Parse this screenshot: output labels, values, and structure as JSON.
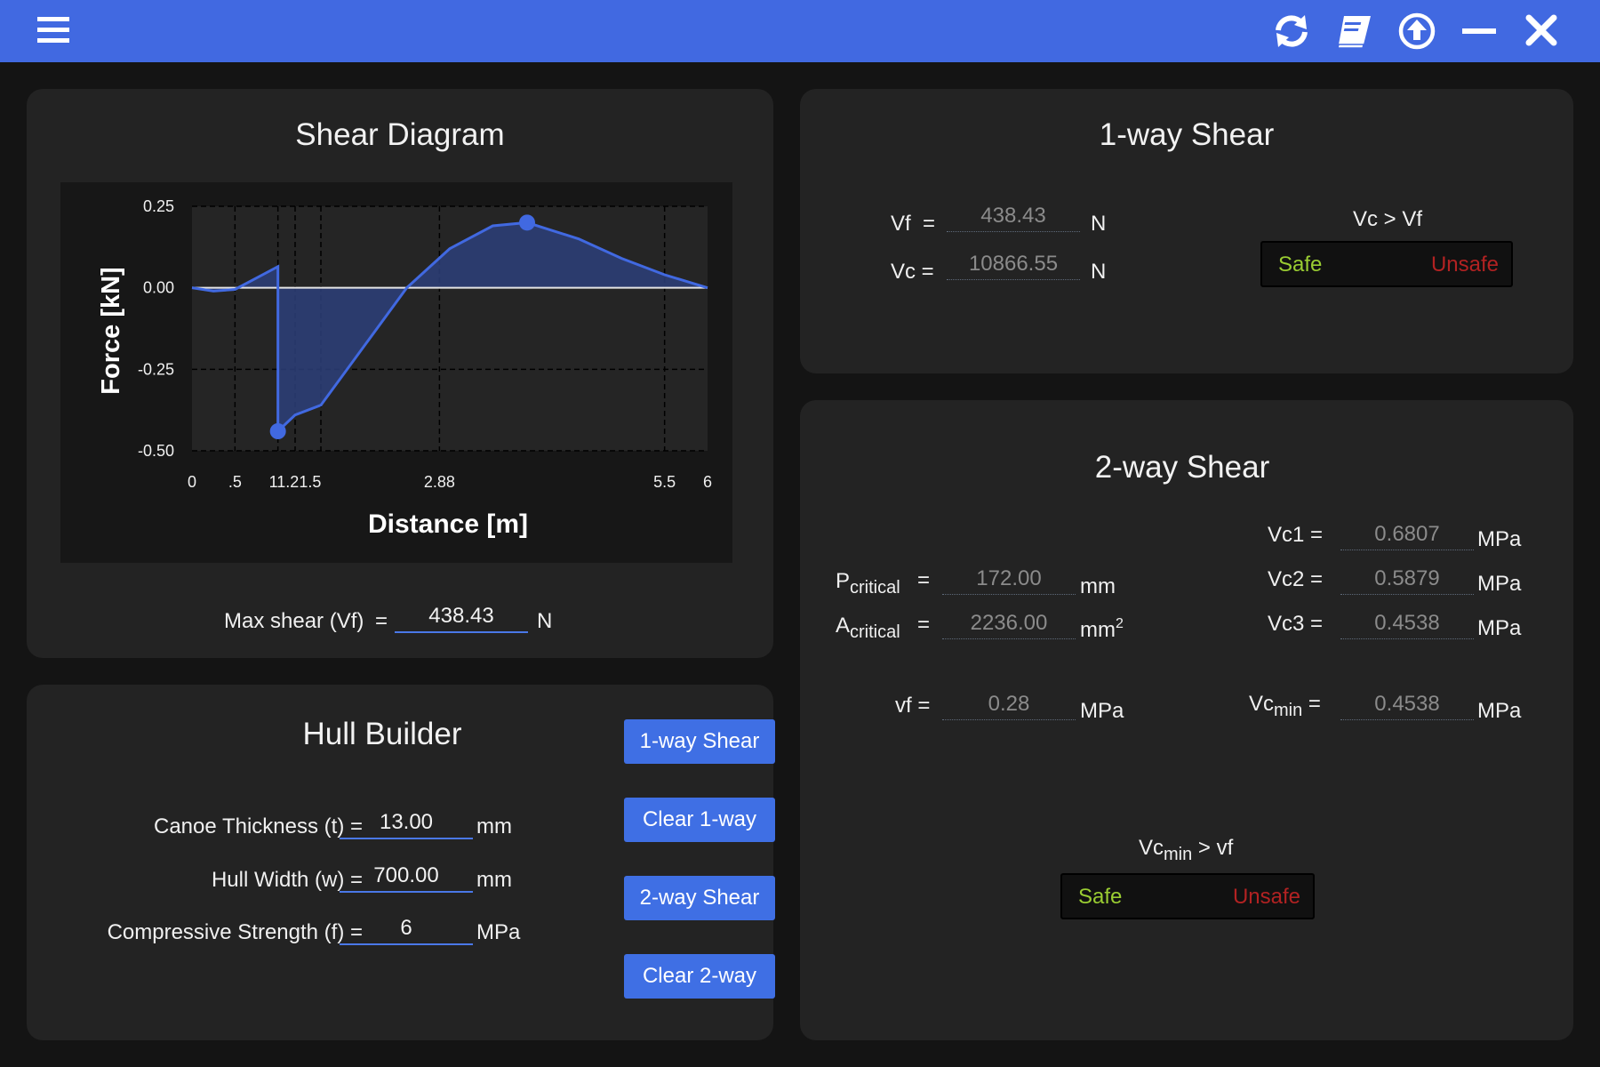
{
  "toolbar": {
    "menu_icon": "hamburger-icon",
    "icons": [
      "refresh-icon",
      "book-icon",
      "upload-icon",
      "minimize-icon",
      "close-icon"
    ]
  },
  "shear_diagram": {
    "title": "Shear Diagram",
    "max_shear_label": "Max shear (Vf)",
    "eq": "=",
    "max_shear_value": "438.43",
    "max_shear_unit": "N"
  },
  "chart_data": {
    "type": "line",
    "xlabel": "Distance [m]",
    "ylabel": "Force [kN]",
    "xlim": [
      0,
      6
    ],
    "ylim": [
      -0.5,
      0.25
    ],
    "x_tick_labels": [
      "0",
      ".5",
      "11.21.5",
      "2.88",
      "5.5",
      "6"
    ],
    "y_tick_labels": [
      "0.25",
      "0.00",
      "-0.25",
      "-0.50"
    ],
    "y_ticks": [
      0.25,
      0.0,
      -0.25,
      -0.5
    ],
    "vertical_dashed_lines": [
      0.5,
      1.0,
      1.2,
      1.5,
      2.88,
      5.5
    ],
    "series": [
      {
        "x": [
          0,
          0.25,
          0.5,
          0.75,
          1.0,
          1.0,
          1.2,
          1.5,
          2.0,
          2.5,
          3.0,
          3.5,
          3.9,
          4.5,
          5.0,
          5.5,
          6.0
        ],
        "y": [
          0.0,
          -0.01,
          -0.005,
          0.03,
          0.065,
          -0.44,
          -0.39,
          -0.36,
          -0.18,
          0.0,
          0.12,
          0.19,
          0.2,
          0.15,
          0.09,
          0.04,
          0.0
        ]
      }
    ],
    "markers": [
      {
        "x": 1.0,
        "y": -0.44
      },
      {
        "x": 3.9,
        "y": 0.2
      }
    ],
    "colors": {
      "line": "#4169e1",
      "fill": "#2d3f7a",
      "zero": "#e6e6e6",
      "grid": "#000000"
    }
  },
  "hull_builder": {
    "title": "Hull Builder",
    "fields": [
      {
        "label": "Canoe Thickness (t) =",
        "value": "13.00",
        "unit": "mm"
      },
      {
        "label": "Hull Width (w) =",
        "value": "700.00",
        "unit": "mm"
      },
      {
        "label": "Compressive Strength (f) =",
        "value": "6",
        "unit": "MPa"
      }
    ],
    "buttons": [
      "1-way Shear",
      "Clear 1-way",
      "2-way Shear",
      "Clear 2-way"
    ]
  },
  "one_way": {
    "title": "1-way Shear",
    "vf_label": "Vf",
    "vc_label": "Vc =",
    "eq": "=",
    "vf_value": "438.43",
    "vc_value": "10866.55",
    "unit": "N",
    "condition": "Vc > Vf",
    "safe": "Safe",
    "unsafe": "Unsafe"
  },
  "two_way": {
    "title": "2-way Shear",
    "p_base": "P",
    "p_sub": "critical",
    "a_base": "A",
    "a_sub": "critical",
    "eq": "=",
    "p_value": "172.00",
    "a_value": "2236.00",
    "mm": "mm",
    "sq": "2",
    "vf_label": "vf =",
    "vf_value": "0.28",
    "mpa": "MPa",
    "vc1_label": "Vc1 =",
    "vc1_value": "0.6807",
    "vc2_label": "Vc2 =",
    "vc2_value": "0.5879",
    "vc3_label": "Vc3 =",
    "vc3_value": "0.4538",
    "vcmin_base": "Vc",
    "vcmin_sub": "min",
    "vcmin_eq": "=",
    "vcmin_value": "0.4538",
    "cond_base": "Vc",
    "cond_sub": "min",
    "cond_rest": "> vf",
    "safe": "Safe",
    "unsafe": "Unsafe"
  }
}
